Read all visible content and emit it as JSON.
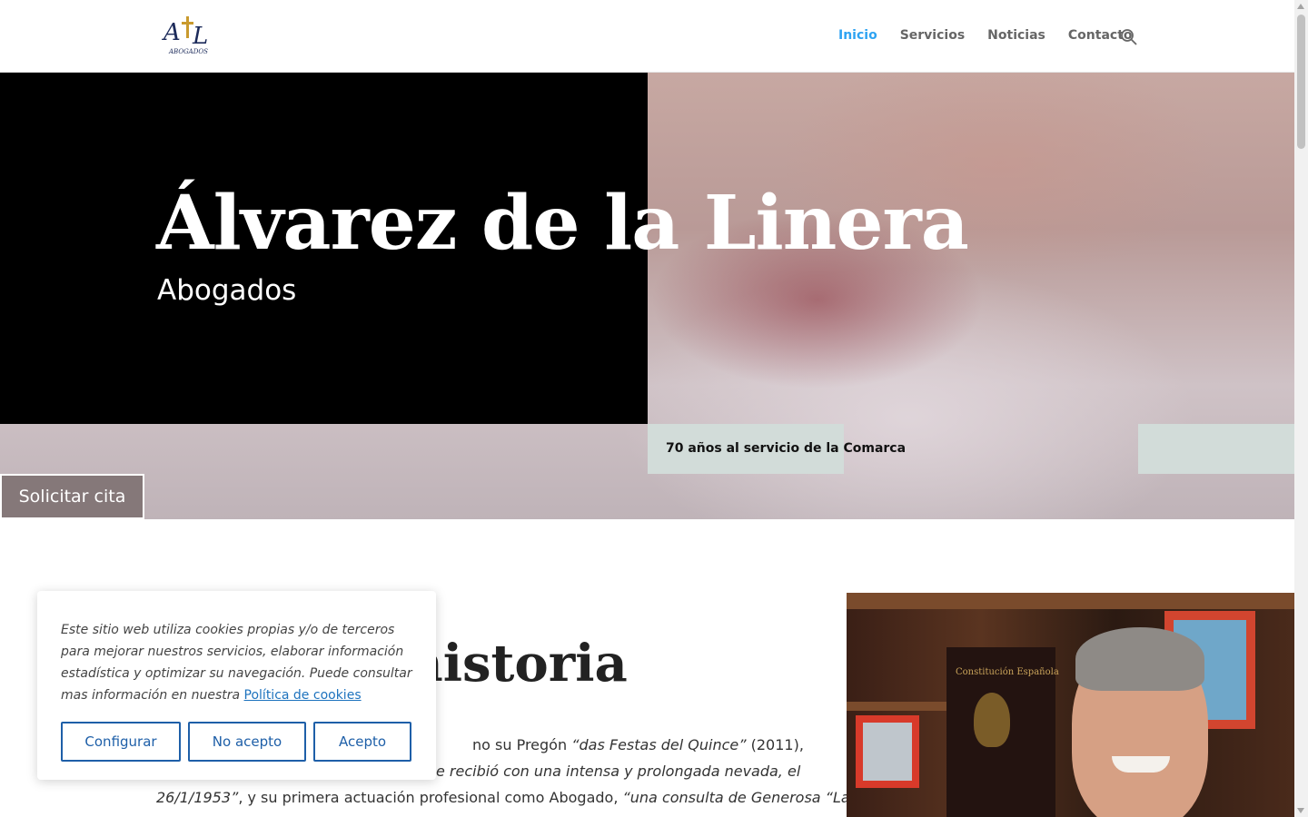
{
  "header": {
    "nav": [
      {
        "label": "Inicio",
        "active": true
      },
      {
        "label": "Servicios",
        "active": false
      },
      {
        "label": "Noticias",
        "active": false
      },
      {
        "label": "Contacto",
        "active": false
      }
    ],
    "search_icon": "search-icon"
  },
  "hero": {
    "title": "Álvarez de la Linera",
    "subtitle": "Abogados",
    "tagline": "70 años al servicio de la Comarca",
    "cta_label": "Solicitar cita"
  },
  "content": {
    "section_title_tail": "historia",
    "para_l1_normal": "no su Pregón ",
    "para_l1_italic": "“das Festas del Quince”",
    "para_l1_tail": " (2011),",
    "para_l2_italic": "e recibió con una intensa y prolongada nevada, el",
    "para_l3_italic": "26/1/1953”",
    "para_l3_normal": ", y su primera actuación profesional como Abogado, ",
    "para_l3_italic2": "“una consulta de Generosa “La"
  },
  "cookie": {
    "text": "Este sitio web utiliza cookies propias y/o de terceros para mejorar nuestros servicios, elaborar información estadística y optimizar su navegación. Puede consultar mas información en nuestra ",
    "link": "Política de cookies",
    "configure": "Configurar",
    "reject": "No acepto",
    "accept": "Acepto"
  },
  "colors": {
    "accent": "#2ea3f2",
    "cookie_button": "#1e5fa8",
    "cta_bg": "#857879",
    "tagline_bg": "#d2dcd9"
  }
}
